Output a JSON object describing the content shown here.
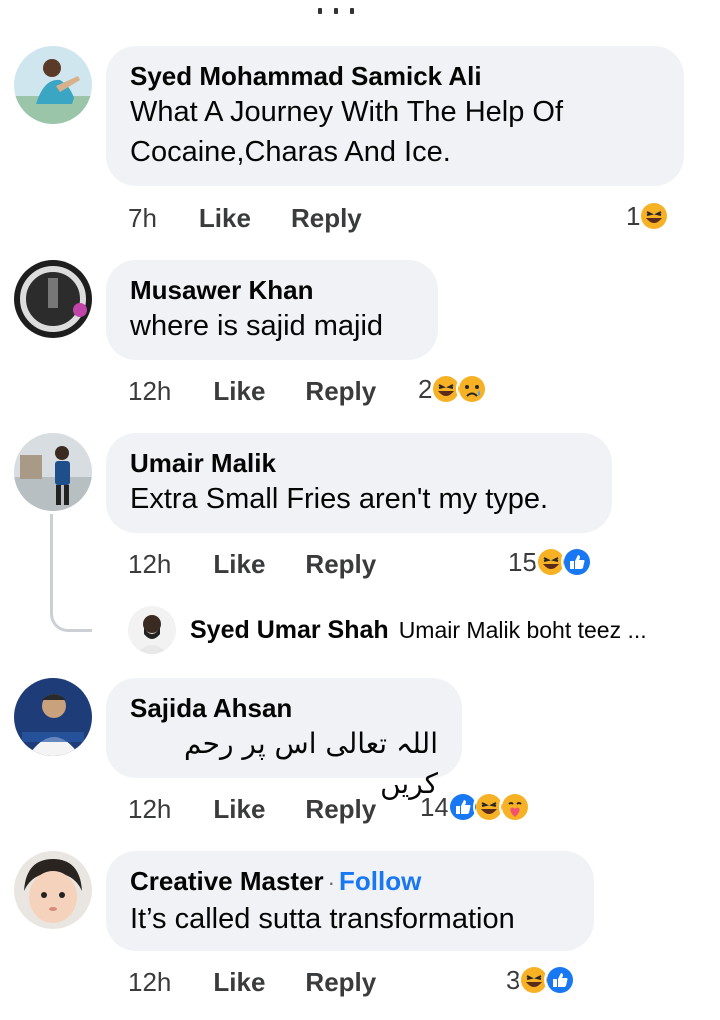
{
  "colors": {
    "bubble": "#f0f2f5",
    "follow": "#1877f2",
    "haha": "#f7b125",
    "like": "#1877f2"
  },
  "comments": [
    {
      "author": "Syed Mohammad Samick Ali",
      "text": "What A Journey With The Help Of Cocaine,Charas And Ice.",
      "time": "7h",
      "like_label": "Like",
      "reply_label": "Reply",
      "reaction_count": "1",
      "reactions": [
        "haha-icon"
      ]
    },
    {
      "author": "Musawer Khan",
      "text": "where is sajid majid",
      "time": "12h",
      "like_label": "Like",
      "reply_label": "Reply",
      "reaction_count": "2",
      "reactions": [
        "haha-icon",
        "sad-icon"
      ]
    },
    {
      "author": "Umair Malik",
      "text": "Extra Small Fries aren't my type.",
      "time": "12h",
      "like_label": "Like",
      "reply_label": "Reply",
      "reaction_count": "15",
      "reactions": [
        "haha-icon",
        "like-icon"
      ],
      "reply_preview": {
        "author": "Syed Umar Shah",
        "text": "Umair Malik boht teez ..."
      }
    },
    {
      "author": "Sajida Ahsan",
      "text": "اللہ تعالی اس پر رحم کریں",
      "time": "12h",
      "like_label": "Like",
      "reply_label": "Reply",
      "reaction_count": "14",
      "reactions": [
        "like-icon",
        "haha-icon",
        "care-icon"
      ]
    },
    {
      "author": "Creative Master",
      "follow_sep": "·",
      "follow_label": "Follow",
      "text": "It’s called sutta transformation",
      "time": "12h",
      "like_label": "Like",
      "reply_label": "Reply",
      "reaction_count": "3",
      "reactions": [
        "haha-icon",
        "like-icon"
      ]
    }
  ]
}
